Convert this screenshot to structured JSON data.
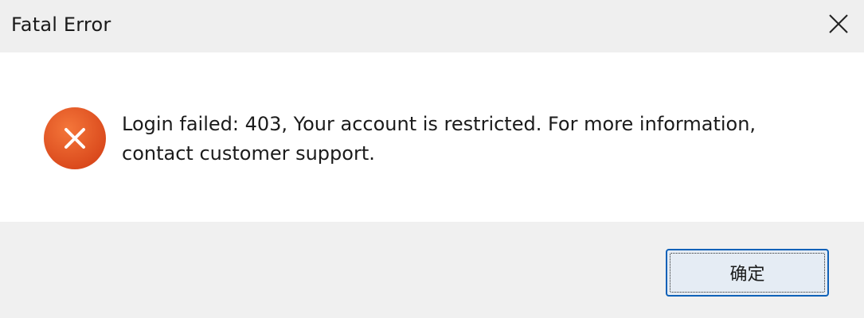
{
  "window": {
    "title": "Fatal Error",
    "close_icon": "close-icon"
  },
  "content": {
    "icon": "error-icon",
    "icon_color": "#e2531f",
    "message": "Login failed: 403, Your account is restricted. For more information,\ncontact customer support."
  },
  "footer": {
    "ok_label": "确定"
  }
}
